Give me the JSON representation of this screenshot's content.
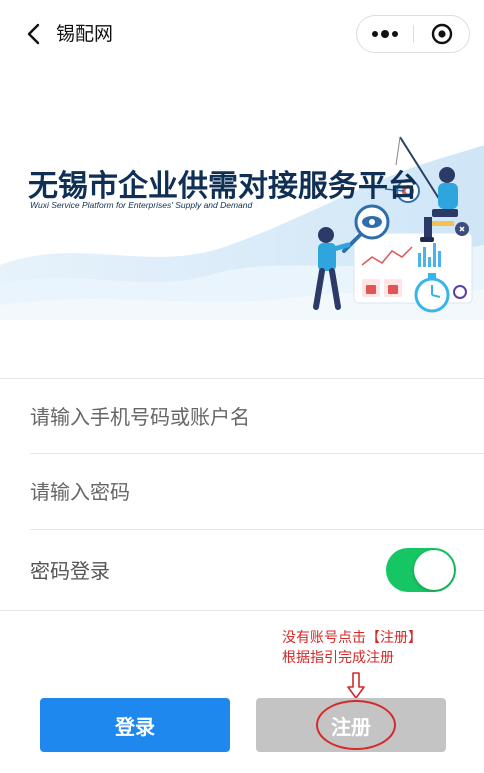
{
  "navbar": {
    "title": "锡配网",
    "back_icon": "chevron-left-icon",
    "more_icon": "more-dots-icon",
    "close_icon": "target-circle-icon"
  },
  "banner": {
    "title": "无锡市企业供需对接服务平台",
    "subtitle": "Wuxi Service Platform for Enterprises' Supply and Demand"
  },
  "form": {
    "account_placeholder": "请输入手机号码或账户名",
    "password_placeholder": "请输入密码",
    "password_login_label": "密码登录",
    "password_login_toggle_on": true,
    "toggle_color": "#16c563"
  },
  "annotation": {
    "line1": "没有账号点击【注册】",
    "line2": "根据指引完成注册",
    "color": "#d42a2a"
  },
  "buttons": {
    "login_label": "登录",
    "register_label": "注册",
    "login_color": "#1e88ef",
    "register_color": "#c4c4c4"
  }
}
